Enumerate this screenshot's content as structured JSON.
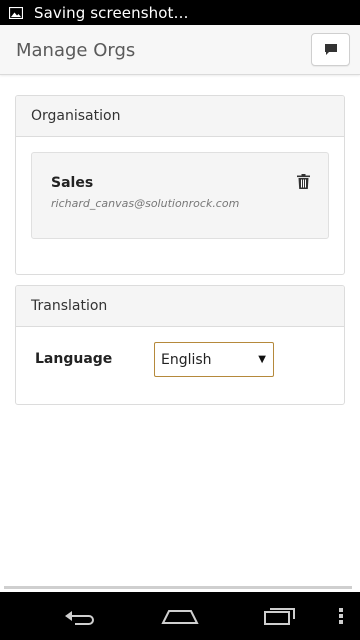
{
  "status_bar": {
    "text": "Saving screenshot…",
    "icon": "image-icon"
  },
  "header": {
    "title": "Manage Orgs",
    "action_icon": "chat-bubble-icon"
  },
  "organisation": {
    "section_title": "Organisation",
    "org": {
      "name": "Sales",
      "email": "richard_canvas@solutionrock.com",
      "delete_icon": "trash-icon"
    }
  },
  "translation": {
    "section_title": "Translation",
    "language_label": "Language",
    "language_value": "English"
  },
  "nav_bar": {
    "back_icon": "back-icon",
    "home_icon": "home-icon",
    "recents_icon": "recents-icon",
    "menu_icon": "overflow-menu-icon"
  },
  "colors": {
    "select_border": "#b5893b",
    "header_bg": "#f7f7f7",
    "card_header_bg": "#f5f5f5"
  }
}
